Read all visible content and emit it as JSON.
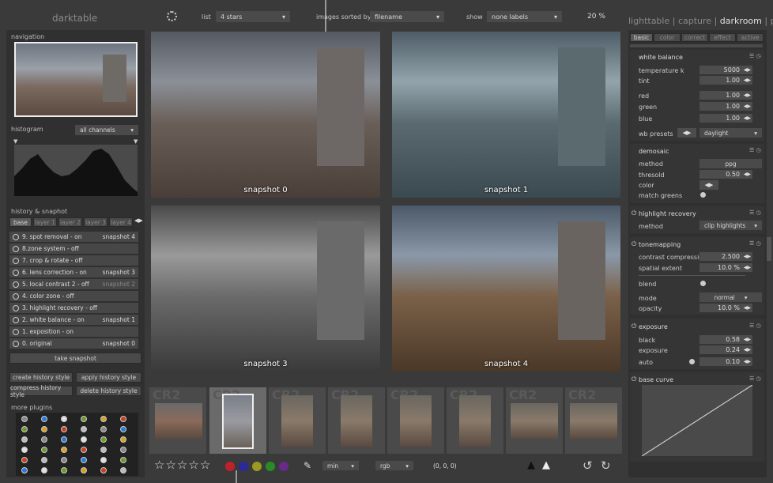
{
  "app": {
    "title": "darktable"
  },
  "topbar": {
    "list_label": "list",
    "list_value": "4 stars",
    "sorted_label": "images sorted by",
    "sorted_value": "filename",
    "show_label": "show",
    "show_value": "none labels",
    "zoom": "20 %"
  },
  "views": {
    "lighttable": "lighttable",
    "sep1": "|",
    "capture": "capture",
    "sep2": "|",
    "darkroom": "darkroom",
    "sep3": "|",
    "print": "print"
  },
  "navigation": {
    "title": "navigation"
  },
  "histogram": {
    "title": "histogram",
    "channels": "all channels"
  },
  "history": {
    "title": "history & snaphot",
    "tabs": [
      "base",
      "layer 1",
      "layer 2",
      "layer 3",
      "layer 4"
    ],
    "items": [
      {
        "label": "9. spot removal - on",
        "snap": "snapshot 4"
      },
      {
        "label": "8.zone system - off",
        "snap": ""
      },
      {
        "label": "7. crop & rotate - off",
        "snap": ""
      },
      {
        "label": "6. lens correction - on",
        "snap": "snapshot 3"
      },
      {
        "label": "5. local contrast 2 - off",
        "snap": "snapshot 2"
      },
      {
        "label": "4. color zone - off",
        "snap": ""
      },
      {
        "label": "3. highlight recovery - off",
        "snap": ""
      },
      {
        "label": "2. white balance - on",
        "snap": "snapshot 1"
      },
      {
        "label": "1. exposition - on",
        "snap": ""
      },
      {
        "label": "0. original",
        "snap": "snapshot 0"
      }
    ],
    "take": "take snapshot",
    "create": "create history style",
    "apply": "apply history style",
    "compress": "compress history style",
    "delete": "delete history style"
  },
  "plugins": {
    "title": "more plugins"
  },
  "snapshots": [
    "snapshot 0",
    "snapshot 1",
    "snapshot 3",
    "snapshot 4"
  ],
  "filmstrip": {
    "cr": "CR2"
  },
  "bottom": {
    "min": "min",
    "rgb": "rgb",
    "coords": "(0, 0, 0)",
    "label_colors": [
      "#c0202a",
      "#2a2a9a",
      "#9a9a20",
      "#2a8a2a",
      "#6a2a8a"
    ]
  },
  "right": {
    "tabs": [
      "basic",
      "color",
      "correct",
      "effect",
      "active"
    ],
    "wb": {
      "title": "white balance",
      "temp_l": "temperature k",
      "temp_v": "5000",
      "tint_l": "tint",
      "tint_v": "1.00",
      "red_l": "red",
      "red_v": "1.00",
      "green_l": "green",
      "green_v": "1.00",
      "blue_l": "blue",
      "blue_v": "1.00",
      "presets_l": "wb presets",
      "presets_v": "daylight"
    },
    "demosaic": {
      "title": "demosaic",
      "method_l": "method",
      "method_v": "ppg",
      "thr_l": "thresold",
      "thr_v": "0.50",
      "color_l": "color",
      "match_l": "match greens"
    },
    "hr": {
      "title": "highlight recovery",
      "method_l": "method",
      "method_v": "clip highlights"
    },
    "tm": {
      "title": "tonemapping",
      "cc_l": "contrast compression",
      "cc_v": "2.500",
      "se_l": "spatial extent",
      "se_v": "10.0 %",
      "blend_l": "blend",
      "mode_l": "mode",
      "mode_v": "normal",
      "op_l": "opacity",
      "op_v": "10.0 %"
    },
    "exp": {
      "title": "exposure",
      "black_l": "black",
      "black_v": "0.58",
      "exp_l": "exposure",
      "exp_v": "0.24",
      "auto_l": "auto",
      "auto_v": "0.10"
    },
    "curve": {
      "title": "base curve"
    }
  }
}
